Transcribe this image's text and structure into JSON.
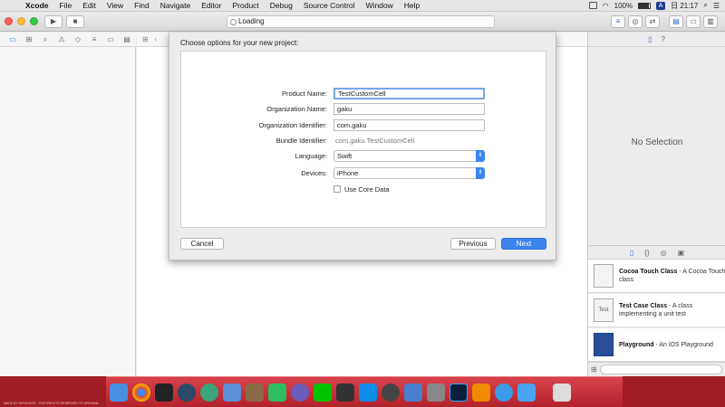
{
  "menubar": {
    "apple": "",
    "app": "Xcode",
    "items": [
      "File",
      "Edit",
      "View",
      "Find",
      "Navigate",
      "Editor",
      "Product",
      "Debug",
      "Source Control",
      "Window",
      "Help"
    ],
    "battery": "100%",
    "input_badge": "A",
    "clock": "日 21:17"
  },
  "toolbar": {
    "activity_text": "Loading"
  },
  "inspector": {
    "no_selection": "No Selection",
    "library": [
      {
        "title": "Cocoa Touch Class",
        "desc": " - A Cocoa Touch class"
      },
      {
        "title": "Test Case Class",
        "desc": " - A class implementing a unit test"
      },
      {
        "title": "Playground",
        "desc": " - An iOS Playground"
      }
    ]
  },
  "sheet": {
    "title": "Choose options for your new project:",
    "product_name": {
      "label": "Product Name:",
      "value": "TestCustomCell"
    },
    "organization_name": {
      "label": "Organization Name:",
      "value": "gaku"
    },
    "organization_identifier": {
      "label": "Organization Identifier:",
      "value": "com.gaku"
    },
    "bundle_identifier": {
      "label": "Bundle Identifier:",
      "value": "com.gaku.TestCustomCell"
    },
    "language": {
      "label": "Language:",
      "value": "Swift"
    },
    "devices": {
      "label": "Devices:",
      "value": "iPhone"
    },
    "core_data": {
      "label": "Use Core Data",
      "checked": false
    },
    "cancel": "Cancel",
    "previous": "Previous",
    "next": "Next"
  },
  "credit": "MADE BY MITSCHOO · COPYRIGHTS RESERVED TO ORIGINAL",
  "colors": {
    "accent": "#3b84f0",
    "dock": "#c52f37"
  },
  "dock_icons": [
    "finder-icon",
    "chrome-icon",
    "terminal-icon",
    "app-icon",
    "atom-icon",
    "thunderbird-icon",
    "gimp-icon",
    "evernote-icon",
    "app-icon",
    "line-icon",
    "unity-icon",
    "teamviewer-icon",
    "app-icon",
    "keynote-icon",
    "app-icon",
    "photoshop-icon",
    "vlc-icon",
    "safari-icon",
    "xcode-icon",
    "trash-icon"
  ]
}
